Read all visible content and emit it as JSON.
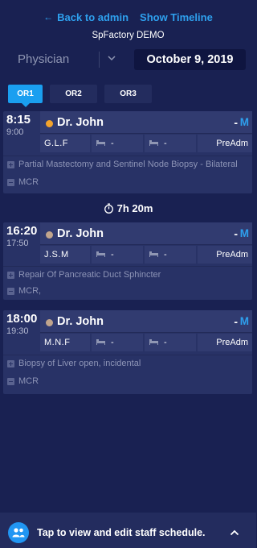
{
  "nav": {
    "back_label": "Back to admin",
    "timeline_label": "Show Timeline"
  },
  "app_title": "SpFactory DEMO",
  "role": {
    "selected": "Physician"
  },
  "date": "October 9, 2019",
  "or_tabs": [
    {
      "label": "OR1",
      "active": true
    },
    {
      "label": "OR2",
      "active": false
    },
    {
      "label": "OR3",
      "active": false
    }
  ],
  "gap_label": "7h 20m",
  "cases": [
    {
      "start": "8:15",
      "end": "9:00",
      "surgeon": "Dr. John",
      "status_dot_color": "#f3a32c",
      "dash": "-",
      "flag": "M",
      "patient": "G.L.F",
      "room1": "-",
      "room2": "-",
      "status": "PreAdm",
      "procedure": "Partial Mastectomy and Sentinel Node Biopsy - Bilateral",
      "note": "MCR"
    },
    {
      "start": "16:20",
      "end": "17:50",
      "surgeon": "Dr. John",
      "status_dot_color": "#c1a58d",
      "dash": "-",
      "flag": "M",
      "patient": "J.S.M",
      "room1": "-",
      "room2": "-",
      "status": "PreAdm",
      "procedure": "Repair Of Pancreatic Duct Sphincter",
      "note": "MCR,"
    },
    {
      "start": "18:00",
      "end": "19:30",
      "surgeon": "Dr. John",
      "status_dot_color": "#c1a58d",
      "dash": "-",
      "flag": "M",
      "patient": "M.N.F",
      "room1": "-",
      "room2": "-",
      "status": "PreAdm",
      "procedure": "Biopsy of Liver open, incidental",
      "note": "MCR"
    }
  ],
  "bottom_bar": {
    "label": "Tap to view and edit staff schedule."
  },
  "colors": {
    "background": "#192152",
    "accent": "#2ea0ee",
    "card": "#283266",
    "tab_active": "#1a9ff0"
  }
}
